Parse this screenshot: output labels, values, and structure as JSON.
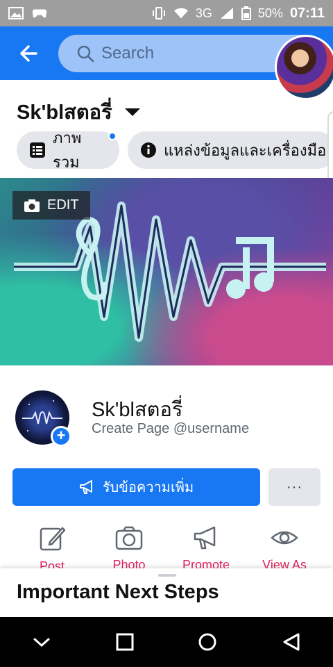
{
  "status_bar": {
    "network": "3G",
    "battery": "50%",
    "time": "07:11"
  },
  "header": {
    "search_placeholder": "Search"
  },
  "page": {
    "title": "Sk'blสตอรี่",
    "tabs": [
      {
        "label": "ภาพรวม"
      },
      {
        "label": "แหล่งข้อมูลและเครื่องมือ"
      }
    ],
    "cover_edit_label": "EDIT",
    "name": "Sk'blสตอรี่",
    "username_hint": "Create Page @username",
    "cta_label": "รับข้อความเพิ่ม",
    "more_label": "···"
  },
  "actions": [
    {
      "label": "Post",
      "icon": "edit-icon"
    },
    {
      "label": "Photo",
      "icon": "camera-icon"
    },
    {
      "label": "Promote",
      "icon": "megaphone-icon"
    },
    {
      "label": "View As",
      "icon": "eye-icon"
    }
  ],
  "sheet": {
    "heading": "Important Next Steps"
  },
  "colors": {
    "brand": "#1877f2",
    "action_text": "#e0245e",
    "status_bar": "#9e9e9e"
  }
}
